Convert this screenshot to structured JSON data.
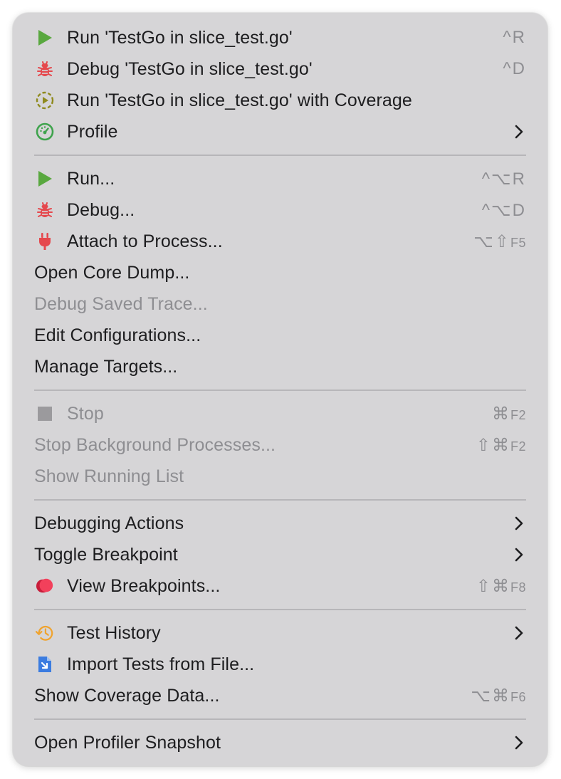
{
  "menu": {
    "items": [
      {
        "label": "Run 'TestGo in slice_test.go'",
        "shortcut": "^R"
      },
      {
        "label": "Debug 'TestGo in slice_test.go'",
        "shortcut": "^D"
      },
      {
        "label": "Run 'TestGo in slice_test.go' with Coverage"
      },
      {
        "label": "Profile"
      },
      {
        "label": "Run...",
        "shortcut": "^⌥R"
      },
      {
        "label": "Debug...",
        "shortcut": "^⌥D"
      },
      {
        "label": "Attach to Process...",
        "shortcut_mods": "⌥⇧",
        "shortcut_key": "F5"
      },
      {
        "label": "Open Core Dump..."
      },
      {
        "label": "Debug Saved Trace..."
      },
      {
        "label": "Edit Configurations..."
      },
      {
        "label": "Manage Targets..."
      },
      {
        "label": "Stop",
        "shortcut_mods": "⌘",
        "shortcut_key": "F2"
      },
      {
        "label": "Stop Background Processes...",
        "shortcut_mods": "⇧⌘",
        "shortcut_key": "F2"
      },
      {
        "label": "Show Running List"
      },
      {
        "label": "Debugging Actions"
      },
      {
        "label": "Toggle Breakpoint"
      },
      {
        "label": "View Breakpoints...",
        "shortcut_mods": "⇧⌘",
        "shortcut_key": "F8"
      },
      {
        "label": "Test History"
      },
      {
        "label": "Import Tests from File..."
      },
      {
        "label": "Show Coverage Data...",
        "shortcut_mods": "⌥⌘",
        "shortcut_key": "F6"
      },
      {
        "label": "Open Profiler Snapshot"
      }
    ]
  },
  "colors": {
    "menu_background": "#d6d5d7",
    "text": "#1d1d1f",
    "disabled_text": "#8e8e92",
    "run_green": "#59a83f",
    "debug_red": "#e5484d",
    "coverage_olive": "#8f8a1d",
    "profile_green": "#3fa34d",
    "breakpoint_pink": "#f2405b",
    "history_orange": "#f0a32e",
    "import_blue": "#3b7ce0"
  },
  "icons": [
    "play-icon",
    "bug-icon",
    "coverage-icon",
    "profiler-gauge-icon",
    "plug-icon",
    "stop-square-icon",
    "breakpoint-icon",
    "history-clock-icon",
    "import-file-icon",
    "chevron-right-icon"
  ]
}
